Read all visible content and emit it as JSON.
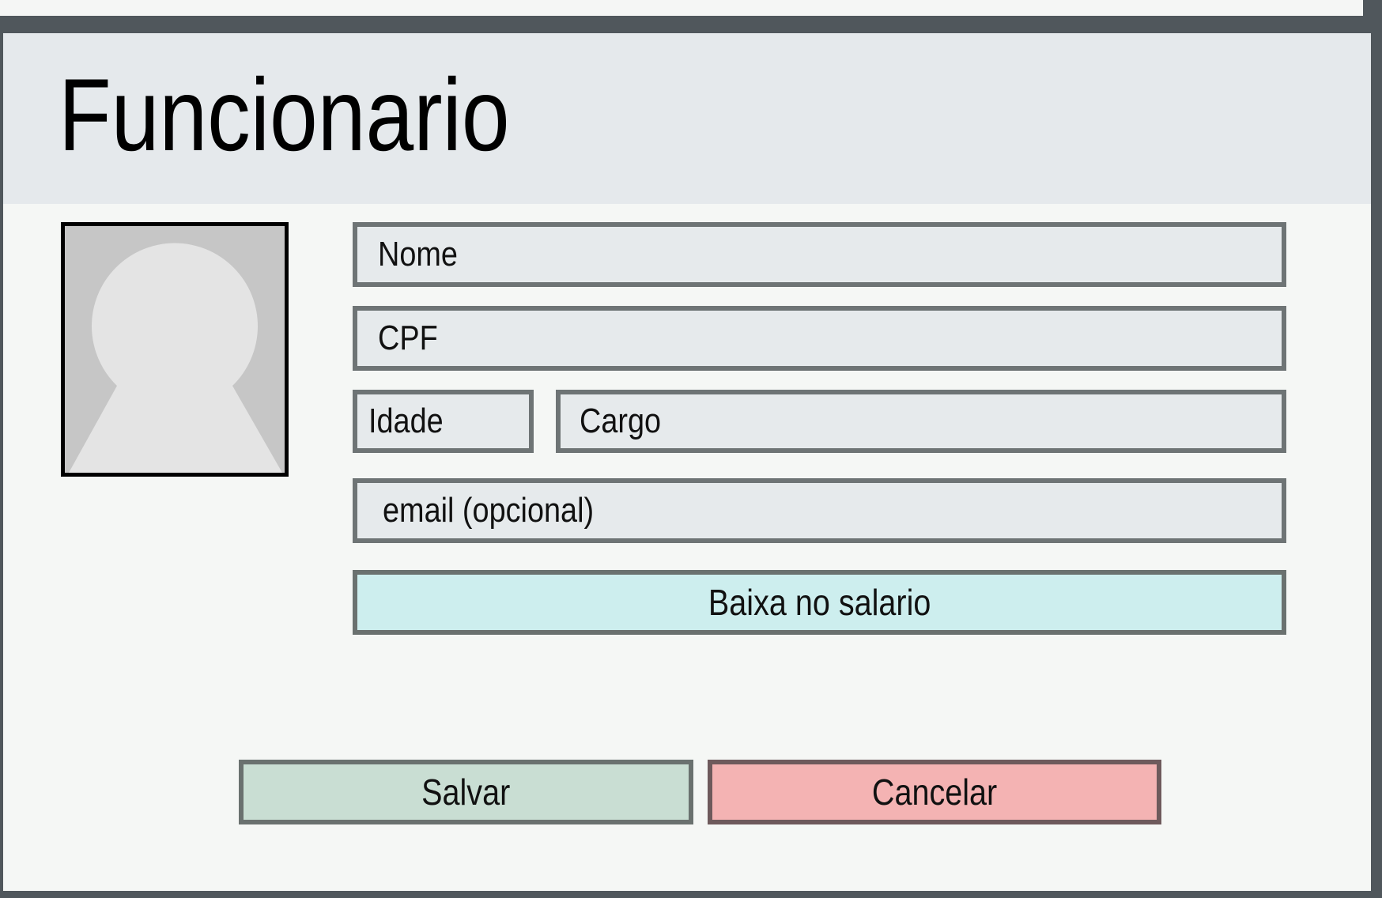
{
  "form": {
    "title": "Funcionario",
    "fields": {
      "nome": "Nome",
      "cpf": "CPF",
      "idade": "Idade",
      "cargo": "Cargo",
      "email": "email (opcional)"
    },
    "buttons": {
      "baixa_salario": "Baixa no salario",
      "salvar": "Salvar",
      "cancelar": "Cancelar"
    }
  },
  "colors": {
    "header_bg": "#e5e9ec",
    "field_bg": "#e6eaec",
    "baixa_bg": "#cdeeee",
    "salvar_bg": "#c9ded3",
    "cancelar_bg": "#f4b3b3"
  },
  "icons": {
    "avatar": "person-placeholder-icon"
  }
}
